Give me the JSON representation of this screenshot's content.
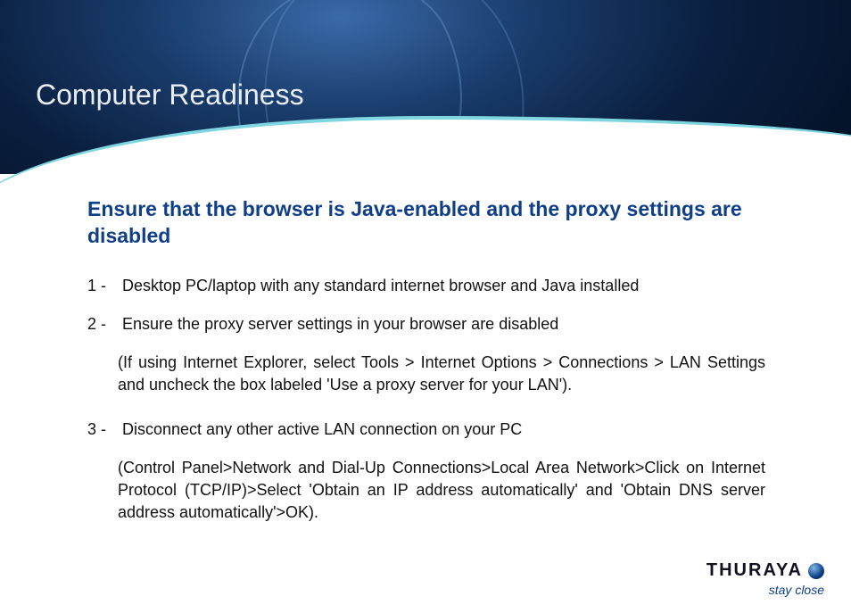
{
  "header": {
    "title": "Computer Readiness"
  },
  "content": {
    "subhead": "Ensure that the browser is Java-enabled and the proxy settings are disabled",
    "items": [
      {
        "num": "1 -",
        "text": "Desktop PC/laptop with any standard  internet browser and Java installed",
        "note": ""
      },
      {
        "num": "2 -",
        "text": "Ensure the proxy server settings in your browser are disabled",
        "note": "(If using Internet Explorer, select Tools > Internet Options > Connections > LAN Settings and uncheck the box labeled 'Use a proxy server for your LAN')."
      },
      {
        "num": "3 -",
        "text": "Disconnect any other active LAN connection on your PC",
        "note": "(Control Panel>Network and Dial-Up Connections>Local Area Network>Click on Internet Protocol (TCP/IP)>Select 'Obtain an IP address automatically' and 'Obtain DNS server address automatically'>OK)."
      }
    ]
  },
  "footer": {
    "brand": "THURAYA",
    "tagline": "stay close"
  }
}
